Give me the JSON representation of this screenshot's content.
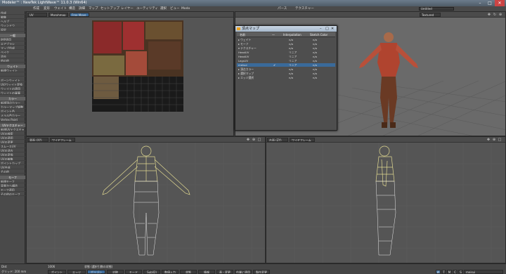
{
  "window": {
    "title": "Modeler™ : NewTek LightWave™ 11.0.3 (Win64)",
    "minimize": "–",
    "maximize": "□",
    "close": "✕"
  },
  "menubar": {
    "items": [
      "作成",
      "変形",
      "ウェイト",
      "構造",
      "詳細",
      "マップ",
      "セットアップ",
      "レイヤー",
      "ユーティリティ",
      "選択",
      "ビュー",
      "Modo"
    ],
    "right_items": [
      "パース",
      "テクスチャー"
    ],
    "preset": "Untitled"
  },
  "sidebar": {
    "sections": [
      {
        "head": "",
        "items": [
          "作成",
          "編集",
          "ヘルプ",
          "ウィンドウ",
          "設定"
        ]
      },
      {
        "head": "一般",
        "items": [
          "IMP適用",
          "エアブラシ",
          "マップ作成",
          "ベイク",
          "消去",
          "他の他"
        ]
      },
      {
        "head": "ウェイト",
        "items": [
          "新規ウェイト",
          ""
        ]
      },
      {
        "head": "",
        "items": [
          "ボーンウェイト",
          "UV/ウェイト変換",
          "ウェイトの適用",
          "ウェイトの乗算"
        ]
      },
      {
        "head": "カラー",
        "items": [
          "新規頂点カラー",
          "カラーマップ調整",
          "ポイント色",
          "メラル色カラー",
          "Vertex Paint"
        ]
      },
      {
        "head": "UVテクスチャー",
        "items": [
          "新規UVテクスチャ",
          "UVの検索",
          "UVの適用",
          "UVの変更",
          "スムースUV",
          "UVの消去",
          "UVの変換",
          "UVの編集",
          "ポイントカップ",
          "UV合成",
          "その他"
        ]
      },
      {
        "head": "モーフ",
        "items": [
          "新規モーフ",
          "背景から構造",
          "モーフ適用",
          "その他のモーフ"
        ]
      }
    ]
  },
  "viewports": {
    "top_left": {
      "label": "UV",
      "mode": "Morphmap",
      "button": "Free Move"
    },
    "bottom_left": {
      "label": "背面 (XY)",
      "mode": "ワイヤフレーム"
    },
    "bottom_right": {
      "label": "右面 (ZY)",
      "mode": "ワイヤフレーム"
    },
    "top_right_mode": "Textured"
  },
  "vmap_panel": {
    "title": "頂点マップ",
    "columns": [
      "名前",
      "—",
      "Interpolation",
      "Sketch Color"
    ],
    "rows": [
      {
        "name": "▸ ウェイト",
        "interp": "n/a",
        "sketch": "n/a",
        "sel": false,
        "check": ""
      },
      {
        "name": "▸ モーフ",
        "interp": "n/a",
        "sketch": "n/a",
        "sel": false,
        "check": ""
      },
      {
        "name": "▾ テクスチャー",
        "interp": "n/a",
        "sketch": "n/a",
        "sel": false,
        "check": ""
      },
      {
        "name": "    HeadUV",
        "interp": "リニア",
        "sketch": "n/a",
        "sel": false,
        "check": ""
      },
      {
        "name": "    HeadUV",
        "interp": "リニア",
        "sketch": "n/a",
        "sel": false,
        "check": ""
      },
      {
        "name": "    LegsUV",
        "interp": "リニア",
        "sketch": "n/a",
        "sel": false,
        "check": ""
      },
      {
        "name": "    meisui",
        "interp": "リニア",
        "sketch": "n/a",
        "sel": true,
        "check": "✔"
      },
      {
        "name": "▸ 頂点カラー",
        "interp": "n/a",
        "sketch": "n/a",
        "sel": false,
        "check": ""
      },
      {
        "name": "▸ 選択マップ",
        "interp": "n/a",
        "sketch": "n/a",
        "sel": false,
        "check": ""
      },
      {
        "name": "▸ エッジ選択",
        "interp": "n/a",
        "sketch": "n/a",
        "sel": false,
        "check": ""
      }
    ]
  },
  "status": {
    "left1": "Dist",
    "left2": "グリッド: 200 mm",
    "value": "1006",
    "msg": "状態 (選択引数の状態)",
    "buttons": [
      "ポイント",
      "エッジ",
      "ポリゴン",
      "対称",
      "モード",
      "Sub(D)",
      "数値入力",
      "状態",
      "情報",
      "表・変更",
      "作業に適用",
      "製作変更"
    ],
    "active_button": "ポリゴン",
    "right_field": "meisui",
    "mode_letters": [
      "W",
      "T",
      "M",
      "C",
      "S"
    ],
    "colors": {
      "accent": "#3a6a9a"
    }
  }
}
